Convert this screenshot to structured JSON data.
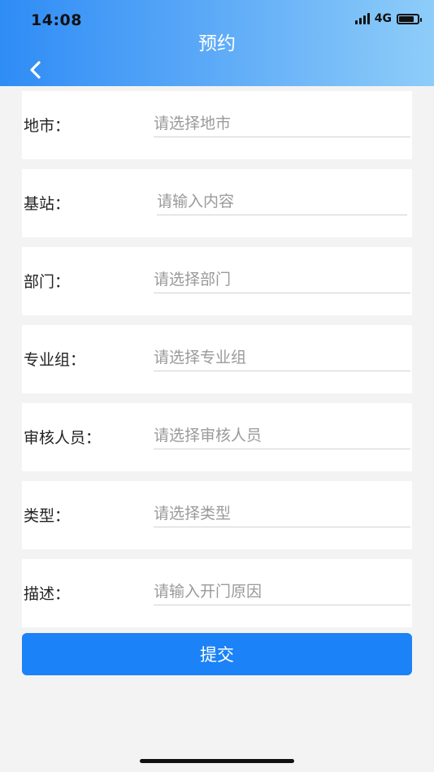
{
  "status_bar": {
    "time": "14:08",
    "network": "4G",
    "battery_level": 0.8
  },
  "header": {
    "title": "预约",
    "back_icon": "chevron-left-icon"
  },
  "form": {
    "fields": [
      {
        "label": "地市：",
        "placeholder": "请选择地市"
      },
      {
        "label": "基站：",
        "placeholder": "请输入内容"
      },
      {
        "label": "部门：",
        "placeholder": "请选择部门"
      },
      {
        "label": "专业组：",
        "placeholder": "请选择专业组"
      },
      {
        "label": "审核人员：",
        "placeholder": "请选择审核人员"
      },
      {
        "label": "类型：",
        "placeholder": "请选择类型"
      },
      {
        "label": "描述：",
        "placeholder": "请输入开门原因"
      }
    ]
  },
  "submit_label": "提交",
  "colors": {
    "header_gradient_start": "#2f8cf6",
    "header_gradient_end": "#8ecdf9",
    "submit_button": "#1b82f7",
    "page_background": "#f3f3f3"
  }
}
